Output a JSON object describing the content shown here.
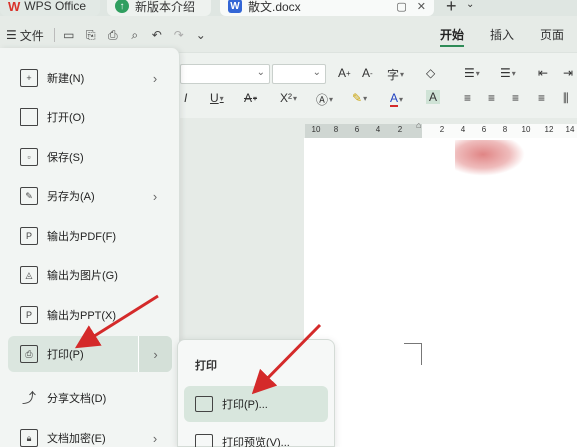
{
  "tabs": {
    "wps_label": "WPS Office",
    "new_label": "新版本介绍",
    "doc_label": "散文.docx"
  },
  "toolbar": {
    "file_label": "文件",
    "ribbon_tabs": [
      "开始",
      "插入",
      "页面"
    ]
  },
  "ribbon": {
    "row1": [
      "A⁺",
      "A⁻",
      "wen",
      "⌫",
      "☰",
      "☰",
      "⇤",
      "⇥"
    ],
    "row2": [
      "I",
      "U",
      "A",
      "X²",
      "A",
      "A",
      "A",
      "A"
    ]
  },
  "ruler": {
    "numbers": [
      "10",
      "8",
      "6",
      "4",
      "2",
      "2",
      "4",
      "6",
      "8",
      "10",
      "12",
      "14"
    ]
  },
  "file_menu": {
    "items": [
      {
        "label": "新建(N)",
        "icon": "new-doc-icon",
        "has_submenu": true
      },
      {
        "label": "打开(O)",
        "icon": "folder-icon",
        "has_submenu": false
      },
      {
        "label": "保存(S)",
        "icon": "save-icon",
        "has_submenu": false
      },
      {
        "label": "另存为(A)",
        "icon": "save-as-icon",
        "has_submenu": true
      },
      {
        "label": "输出为PDF(F)",
        "icon": "pdf-icon",
        "has_submenu": false
      },
      {
        "label": "输出为图片(G)",
        "icon": "image-icon",
        "has_submenu": false
      },
      {
        "label": "输出为PPT(X)",
        "icon": "ppt-icon",
        "has_submenu": false
      },
      {
        "label": "打印(P)",
        "icon": "printer-icon",
        "has_submenu": true
      },
      {
        "label": "分享文档(D)",
        "icon": "share-icon",
        "has_submenu": false
      },
      {
        "label": "文档加密(E)",
        "icon": "lock-icon",
        "has_submenu": true
      }
    ]
  },
  "submenu": {
    "title": "打印",
    "items": [
      {
        "label": "打印(P)...",
        "icon": "printer-icon"
      },
      {
        "label": "打印预览(V)...",
        "icon": "print-preview-icon"
      }
    ]
  },
  "colors": {
    "accent": "#2e8b57",
    "arrow": "#d42a2a",
    "highlight": "#d8e6dd"
  }
}
